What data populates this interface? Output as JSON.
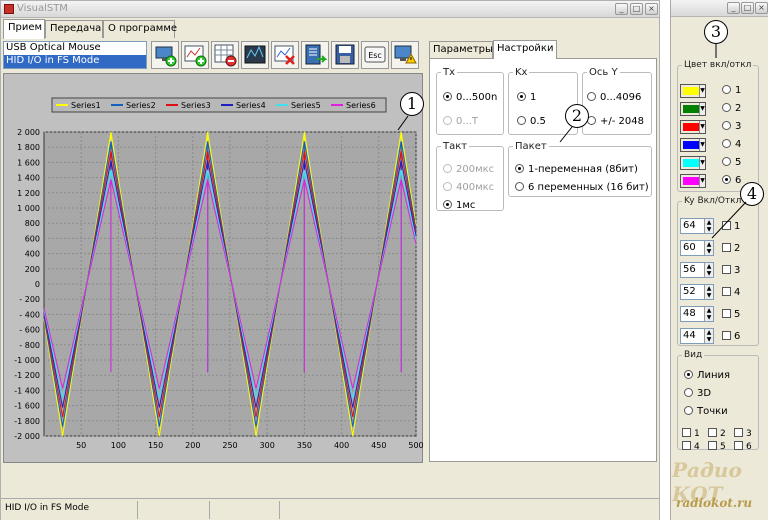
{
  "window": {
    "title": "VisualSTM",
    "window_buttons": [
      "_",
      "□",
      "×"
    ]
  },
  "tabs": [
    "Прием",
    "Передача",
    "О программе"
  ],
  "device_list": [
    "USB Optical Mouse",
    "HID I/O in FS Mode"
  ],
  "toolbar": {
    "icons": [
      "monitor-add-icon",
      "chart-add-icon",
      "table-remove-icon",
      "waveform-icon",
      "chart-delete-icon",
      "book-export-icon",
      "save-icon",
      "escape-icon",
      "monitor-warning-icon"
    ],
    "esc_label": "Esc"
  },
  "chart_data": {
    "type": "line",
    "series": [
      {
        "name": "Series1",
        "color": "#ffff00",
        "amplitude": 2000
      },
      {
        "name": "Series2",
        "color": "#1560bd",
        "amplitude": 1875
      },
      {
        "name": "Series3",
        "color": "#e01010",
        "amplitude": 1750
      },
      {
        "name": "Series4",
        "color": "#2020c0",
        "amplitude": 1625
      },
      {
        "name": "Series5",
        "color": "#40e0f0",
        "amplitude": 1500
      },
      {
        "name": "Series6",
        "color": "#e020e0",
        "amplitude": 1375
      }
    ],
    "x_ticks": [
      "50",
      "100",
      "150",
      "200",
      "250",
      "300",
      "350",
      "400",
      "450",
      "500"
    ],
    "y_ticks": [
      "2 000",
      "1 800",
      "1 600",
      "1 400",
      "1 200",
      "1 000",
      "800",
      "600",
      "400",
      "200",
      "0",
      "- 200",
      "- 400",
      "- 600",
      "- 800",
      "-1 000",
      "-1 200",
      "-1 400",
      "-1 600",
      "-1 800",
      "-2 000"
    ],
    "xlim": [
      0,
      500
    ],
    "ylim": [
      -2000,
      2000
    ],
    "period": 130,
    "peak_x": [
      90,
      220,
      350,
      480
    ],
    "trough_x": [
      25,
      155,
      285,
      415
    ],
    "grid": true,
    "legend": "top",
    "plot_background": "#a8a8a8"
  },
  "right_tabs": [
    "Параметры",
    "Настройки"
  ],
  "settings": {
    "tx": {
      "label": "Tx",
      "options": [
        "0...500n",
        "0...T"
      ],
      "selected": 0
    },
    "kx": {
      "label": "Kx",
      "options": [
        "1",
        "0.5"
      ],
      "selected": 0
    },
    "axis_y": {
      "label": "Ось Y",
      "options": [
        "0...4096",
        "+/- 2048"
      ],
      "selected": -1
    },
    "takt": {
      "label": "Такт",
      "options": [
        "200мкс",
        "400мкс",
        "1мс"
      ],
      "selected": 2
    },
    "packet": {
      "label": "Пакет",
      "options": [
        "1-переменная (8бит)",
        "6 переменных (16 бит)"
      ],
      "selected": 0
    }
  },
  "side_panel": {
    "color_group_label": "Цвет вкл/откл",
    "colors": [
      "#ffff00",
      "#008000",
      "#ff0000",
      "#0000ff",
      "#00ffff",
      "#ff00ff"
    ],
    "color_radios": [
      "1",
      "2",
      "3",
      "4",
      "5",
      "6"
    ],
    "ky_group_label": "Ky",
    "onoff_label": "Вкл/Откл",
    "ky_values": [
      "64",
      "60",
      "56",
      "52",
      "48",
      "44"
    ],
    "channels": [
      "1",
      "2",
      "3",
      "4",
      "5",
      "6"
    ],
    "view_group_label": "Вид",
    "view_options": [
      "Линия",
      "3D",
      "Точки"
    ],
    "view_selected": 0,
    "view_checkboxes": [
      "1",
      "2",
      "3",
      "4",
      "5",
      "6"
    ]
  },
  "status": {
    "text": "HID I/O in FS Mode"
  },
  "annotations": [
    "1",
    "2",
    "3",
    "4"
  ],
  "watermark": {
    "line1": "Радио КОТ",
    "line2": "radiokot.ru"
  }
}
